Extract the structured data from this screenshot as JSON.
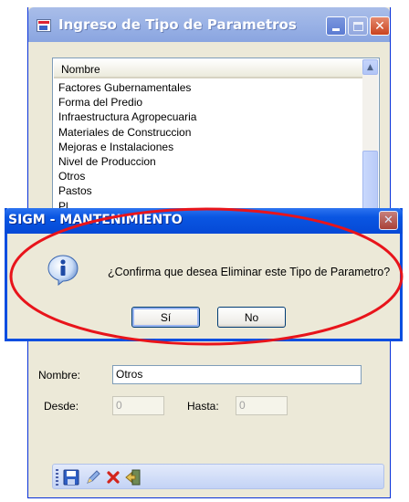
{
  "main_window": {
    "title": "Ingreso de Tipo de Parametros",
    "list": {
      "column_header": "Nombre",
      "rows": [
        "Factores Gubernamentales",
        "Forma del Predio",
        "Infraestructura Agropecuaria",
        "Materiales de Construccion",
        "Mejoras e Instalaciones",
        "Nivel de Produccion",
        "Otros",
        "Pastos",
        "Pl"
      ]
    },
    "form": {
      "nombre_label": "Nombre:",
      "nombre_value": "Otros",
      "desde_label": "Desde:",
      "desde_value": "0",
      "hasta_label": "Hasta:",
      "hasta_value": "0"
    },
    "toolbar": {
      "icons": [
        "save-icon",
        "edit-icon",
        "delete-icon",
        "exit-icon"
      ]
    }
  },
  "dialog": {
    "title": "SIGM - MANTENIMIENTO",
    "message": "¿Confirma que desea Eliminar este Tipo de Parametro?",
    "yes_label": "Sí",
    "no_label": "No",
    "icon": "info-icon"
  },
  "colors": {
    "dialog_titlebar": "#0a56e2",
    "annotation": "#e8141b",
    "window_face": "#ece9d8"
  }
}
